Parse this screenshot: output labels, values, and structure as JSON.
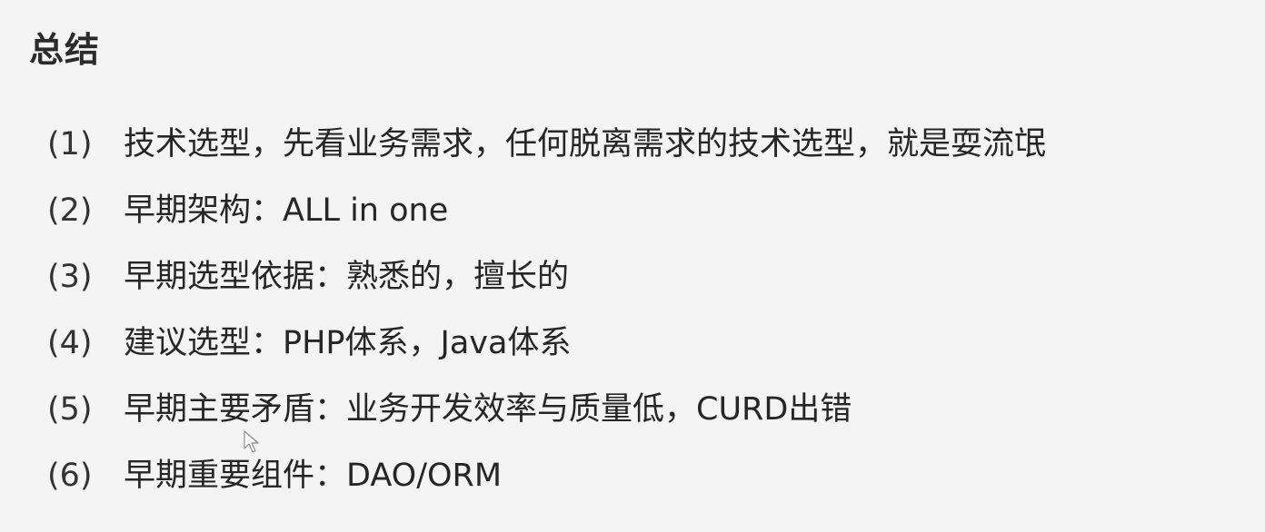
{
  "slide": {
    "title": "总结",
    "items": [
      {
        "num": "(1)",
        "text": "技术选型，先看业务需求，任何脱离需求的技术选型，就是耍流氓"
      },
      {
        "num": "(2)",
        "text": "早期架构：ALL in one"
      },
      {
        "num": "(3)",
        "text": "早期选型依据：熟悉的，擅长的"
      },
      {
        "num": "(4)",
        "text": "建议选型：PHP体系，Java体系"
      },
      {
        "num": "(5)",
        "text": "早期主要矛盾：业务开发效率与质量低，CURD出错"
      },
      {
        "num": "(6)",
        "text": "早期重要组件：DAO/ORM"
      }
    ]
  },
  "cursor": {
    "icon": "mouse-pointer-icon"
  }
}
